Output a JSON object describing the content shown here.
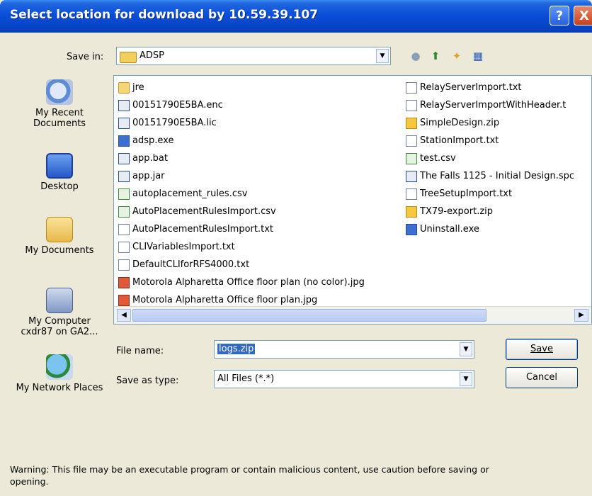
{
  "window": {
    "title": "Select location for download by 10.59.39.107",
    "help_glyph": "?",
    "close_glyph": "X"
  },
  "save_in": {
    "label": "Save in:",
    "value": "ADSP"
  },
  "places": [
    {
      "label": "My Recent Documents",
      "icon": "recent-documents-icon"
    },
    {
      "label": "Desktop",
      "icon": "desktop-icon"
    },
    {
      "label": "My Documents",
      "icon": "my-documents-icon"
    },
    {
      "label": "My Computer cxdr87 on GA2...",
      "icon": "my-computer-icon"
    },
    {
      "label": "My Network Places",
      "icon": "network-places-icon"
    }
  ],
  "files_col1": [
    {
      "name": "jre",
      "type": "folder"
    },
    {
      "name": "00151790E5BA.enc",
      "type": "enc"
    },
    {
      "name": "00151790E5BA.lic",
      "type": "enc"
    },
    {
      "name": "adsp.exe",
      "type": "exe"
    },
    {
      "name": "app.bat",
      "type": "enc"
    },
    {
      "name": "app.jar",
      "type": "enc"
    },
    {
      "name": "autoplacement_rules.csv",
      "type": "csv"
    },
    {
      "name": "AutoPlacementRulesImport.csv",
      "type": "csv"
    },
    {
      "name": "AutoPlacementRulesImport.txt",
      "type": "txt"
    },
    {
      "name": "CLIVariablesImport.txt",
      "type": "txt"
    },
    {
      "name": "DefaultCLIforRFS4000.txt",
      "type": "txt"
    },
    {
      "name": "Motorola Alpharetta Office floor plan (no color).jpg",
      "type": "jpg"
    },
    {
      "name": "Motorola Alpharetta Office floor plan.jpg",
      "type": "jpg"
    }
  ],
  "files_col2": [
    {
      "name": "RelayServerImport.txt",
      "type": "txt"
    },
    {
      "name": "RelayServerImportWithHeader.t",
      "type": "txt"
    },
    {
      "name": "SimpleDesign.zip",
      "type": "zip"
    },
    {
      "name": "StationImport.txt",
      "type": "txt"
    },
    {
      "name": "test.csv",
      "type": "csv"
    },
    {
      "name": "The Falls 1125 - Initial Design.spc",
      "type": "enc"
    },
    {
      "name": "TreeSetupImport.txt",
      "type": "txt"
    },
    {
      "name": "TX79-export.zip",
      "type": "zip"
    },
    {
      "name": "Uninstall.exe",
      "type": "exe"
    }
  ],
  "file_name": {
    "label": "File name:",
    "value": "logs.zip"
  },
  "save_as_type": {
    "label": "Save as type:",
    "value": "All Files (*.*)"
  },
  "buttons": {
    "save": "Save",
    "cancel": "Cancel"
  },
  "warning": "Warning: This file may be an executable program or contain malicious content, use caution before saving or opening.",
  "colors": {
    "titlebar": "#0a4fd8",
    "dialog_bg": "#ECE9D8",
    "selection": "#316ac5"
  }
}
